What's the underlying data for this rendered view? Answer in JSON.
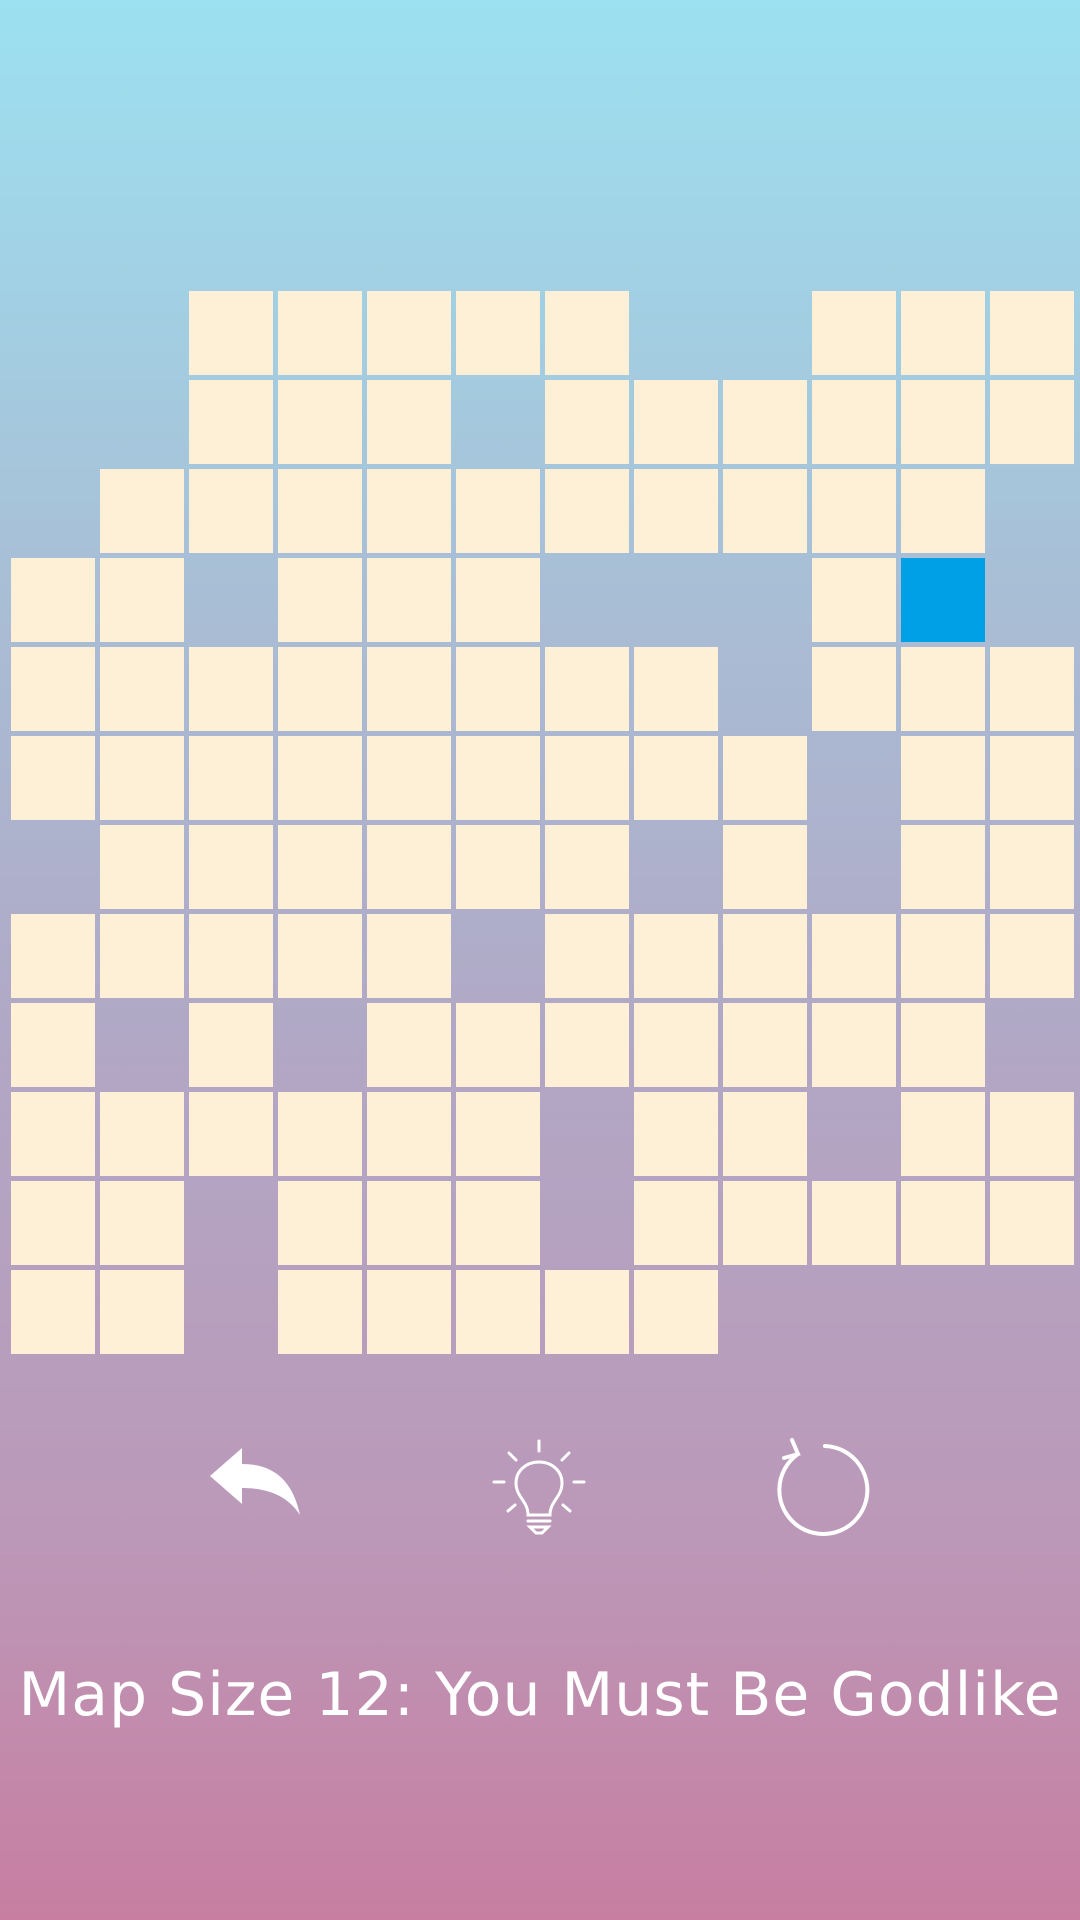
{
  "board": {
    "size": 12,
    "rows": [
      "..11111..111",
      "..111.111111",
      ".1111111111.",
      "11.111...1P.",
      "11111111.111",
      "111111111.11",
      ".111111.1.11",
      "11111.111111",
      "1.1.1111111.",
      "111111.11.11",
      "11.111.11111",
      "11.11111...."
    ],
    "colors": {
      "cell": "#fef0d6",
      "current": "#00a0e6"
    }
  },
  "controls": {
    "undo_icon": "undo-arrow-icon",
    "hint_icon": "lightbulb-icon",
    "restart_icon": "restart-icon"
  },
  "status": {
    "text": "Map Size 12: You Must Be Godlike"
  }
}
